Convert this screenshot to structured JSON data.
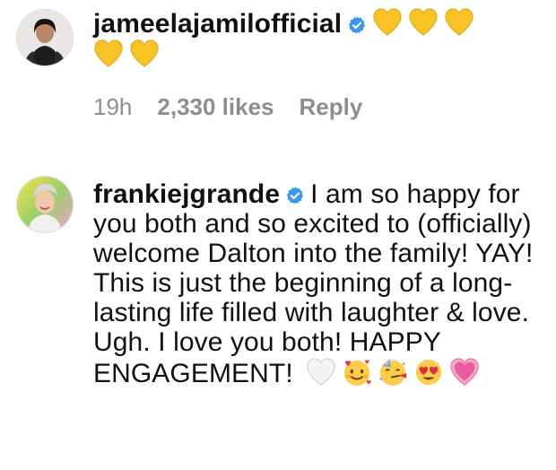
{
  "comments": [
    {
      "username": "jameelajamilofficial",
      "verified_icon": "verified-badge-icon",
      "emojis": [
        "yellow-heart-icon",
        "yellow-heart-icon",
        "yellow-heart-icon",
        "yellow-heart-icon",
        "yellow-heart-icon"
      ],
      "time": "19h",
      "likes": "2,330 likes",
      "reply": "Reply"
    },
    {
      "username": "frankiejgrande",
      "verified_icon": "verified-badge-icon",
      "text": "I am so happy for you both and so excited to (officially) welcome Dalton into the family! YAY! This is just the beginning of a long-lasting life filled with laughter & love. Ugh. I love you both! HAPPY ENGAGEMENT!",
      "emojis": [
        "white-heart-icon",
        "smiling-face-with-hearts-icon",
        "partying-face-icon",
        "heart-eyes-icon",
        "growing-heart-icon"
      ]
    }
  ],
  "colors": {
    "verified": "#3897f0",
    "meta_text": "#8e8e8e",
    "yellow_heart": "#f7c325",
    "pink_heart": "#e85aa4"
  }
}
